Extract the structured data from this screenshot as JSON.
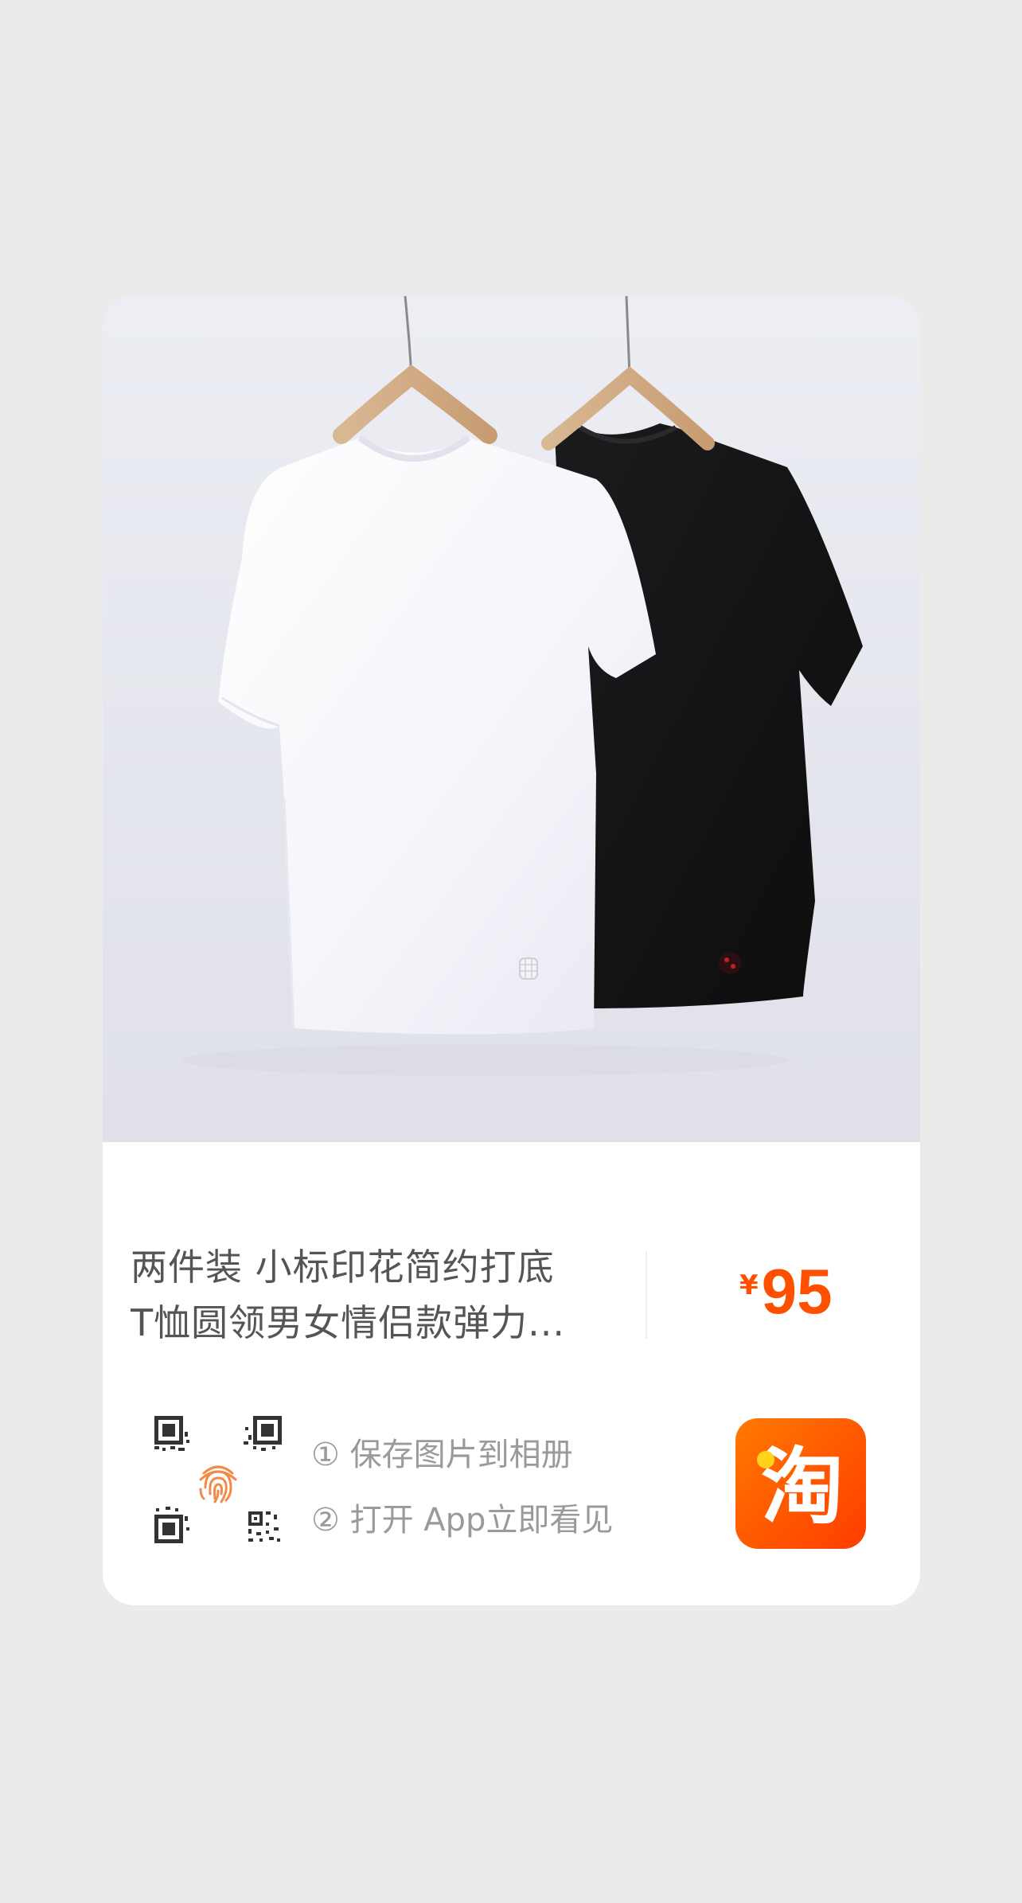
{
  "product": {
    "title_line1": "两件装 小标印花简约打底",
    "title_line2": "T恤圆领男女情侣款弹力...",
    "price_currency": "¥",
    "price_value": "95"
  },
  "share": {
    "step1": "① 保存图片到相册",
    "step2": "② 打开 App立即看见",
    "qr_icon": "qr-code-fingerprint-icon"
  },
  "brand": {
    "logo_icon": "taobao-logo-icon",
    "logo_char": "淘"
  },
  "colors": {
    "background": "#ebebeb",
    "card": "#ffffff",
    "price": "#ff5000",
    "title_text": "#555555",
    "step_text": "#9a9a9a",
    "brand_orange": "#ff5a00"
  }
}
